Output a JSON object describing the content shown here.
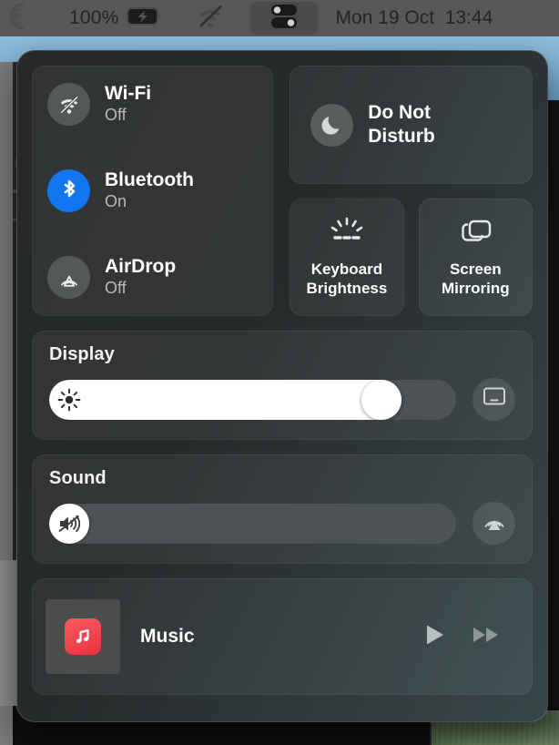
{
  "menubar": {
    "siri_icon": "siri-swirl-icon",
    "battery_percent": "100%",
    "battery_icon": "battery-charging-icon",
    "wifi_icon": "wifi-off-icon",
    "control_center_icon": "control-center-toggles-icon",
    "clock": "Mon 19 Oct  13:44",
    "background": "#585858",
    "text_color": "#232323"
  },
  "control_center": {
    "connectivity": {
      "items": [
        {
          "name": "Wi-Fi",
          "state": "Off",
          "icon": "wifi-off-icon",
          "active": false
        },
        {
          "name": "Bluetooth",
          "state": "On",
          "icon": "bluetooth-icon",
          "active": true
        },
        {
          "name": "AirDrop",
          "state": "Off",
          "icon": "airdrop-icon",
          "active": false
        }
      ],
      "active_color": "#1176f0",
      "inactive_color": "#555859"
    },
    "do_not_disturb": {
      "label_line1": "Do Not",
      "label_line2": "Disturb",
      "icon": "moon-icon",
      "active": false
    },
    "tiles": [
      {
        "label_line1": "Keyboard",
        "label_line2": "Brightness",
        "icon": "keyboard-brightness-icon"
      },
      {
        "label_line1": "Screen",
        "label_line2": "Mirroring",
        "icon": "screen-mirroring-icon"
      }
    ],
    "display": {
      "title": "Display",
      "slider_value": 85,
      "slider_icon": "sun-brightness-icon",
      "side_button_icon": "display-icon"
    },
    "sound": {
      "title": "Sound",
      "slider_value": 0,
      "slider_icon": "speaker-muted-icon",
      "side_button_icon": "airplay-audio-icon"
    },
    "music": {
      "title": "Music",
      "app_icon": "music-note-icon",
      "app_icon_color": "#e8333f",
      "album_art_icon": "album-art-placeholder",
      "controls": [
        {
          "icon": "play-icon",
          "name": "play-button"
        },
        {
          "icon": "fast-forward-icon",
          "name": "fast-forward-button"
        }
      ]
    }
  }
}
